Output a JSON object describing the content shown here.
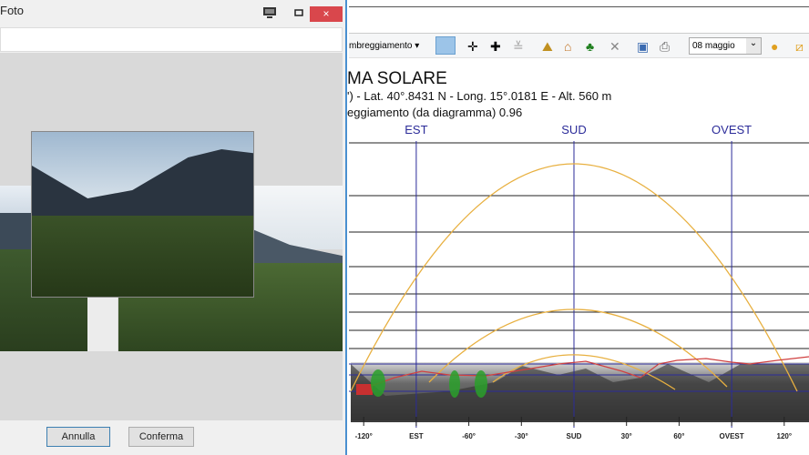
{
  "dialog": {
    "title": "Foto",
    "cancel_label": "Annulla",
    "confirm_label": "Conferma",
    "close_glyph": "×"
  },
  "toolbar": {
    "shading_menu": "mbreggiamento ▾",
    "date_select": "08 maggio",
    "date_arrow": "⌄"
  },
  "diagram": {
    "title": "MA SOLARE",
    "location_line": "') - Lat. 40°.8431 N - Long. 15°.0181 E - Alt. 560 m",
    "shading_line": "eggiamento (da diagramma) 0.96",
    "top_labels": [
      "EST",
      "SUD",
      "OVEST"
    ],
    "tick_labels": [
      "-120°",
      "EST",
      "-60°",
      "-30°",
      "SUD",
      "30°",
      "60°",
      "OVEST",
      "120°"
    ],
    "colors": {
      "grid": "#2b2b99",
      "sun_path": "#e8b040",
      "horizon": "#d04040",
      "obstacle": "#2aa02a"
    }
  }
}
